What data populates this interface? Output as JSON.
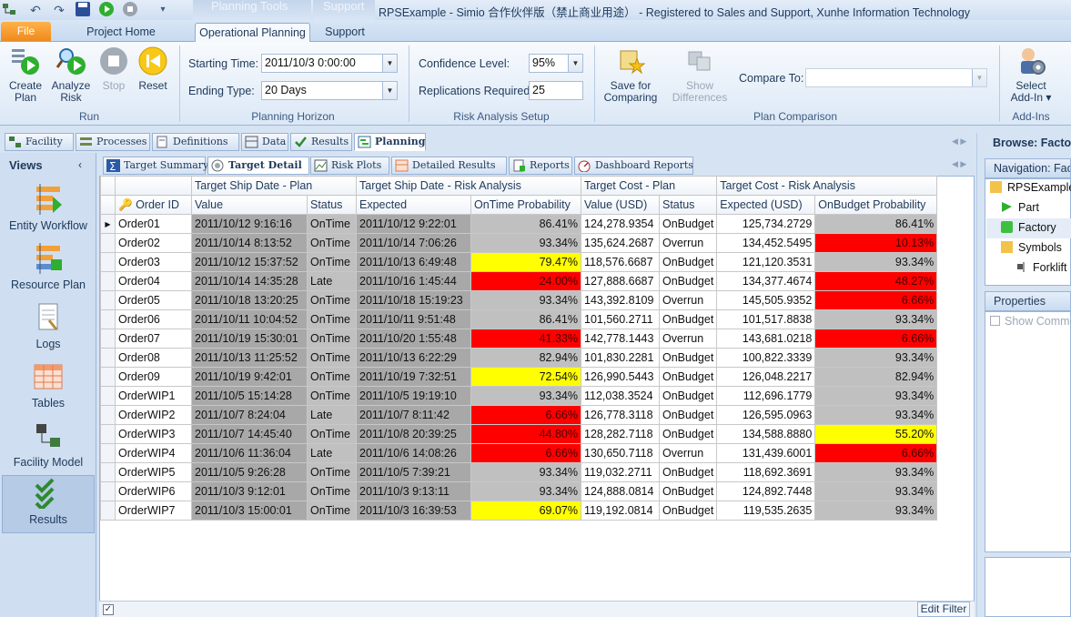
{
  "title_bar": {
    "text": "RPSExample - Simio 合作伙伴版（禁止商业用途） - Registered to Sales and Support, Xunhe Information Technology",
    "context_tabs": [
      "Planning Tools",
      "Support"
    ]
  },
  "ribbon_tabs": {
    "file": "File",
    "project_home": "Project Home",
    "operational_planning": "Operational Planning",
    "support": "Support"
  },
  "ribbon": {
    "run": {
      "label": "Run",
      "buttons": [
        "Create Plan",
        "Analyze Risk",
        "Stop",
        "Reset"
      ]
    },
    "planning_horizon": {
      "label": "Planning Horizon",
      "starting_time_label": "Starting Time:",
      "starting_time_value": "2011/10/3 0:00:00",
      "ending_type_label": "Ending Type:",
      "ending_type_value": "20 Days"
    },
    "risk_analysis_setup": {
      "label": "Risk Analysis Setup",
      "confidence_label": "Confidence Level:",
      "confidence_value": "95%",
      "replications_label": "Replications Required:",
      "replications_value": "25"
    },
    "plan_comparison": {
      "label": "Plan Comparison",
      "save_btn": "Save for Comparing",
      "show_diff_btn": "Show Differences",
      "compare_to_label": "Compare To:"
    },
    "add_ins": {
      "label": "Add-Ins",
      "select_btn": "Select Add-In"
    }
  },
  "doc_tabs": [
    "Facility",
    "Processes",
    "Definitions",
    "Data",
    "Results",
    "Planning"
  ],
  "views": {
    "title": "Views",
    "items": [
      "Entity Workflow",
      "Resource Plan",
      "Logs",
      "Tables",
      "Facility Model",
      "Results"
    ]
  },
  "inner_tabs": [
    "Target Summary",
    "Target Detail",
    "Risk Plots",
    "Detailed Results",
    "Reports",
    "Dashboard Reports"
  ],
  "grid": {
    "group_headers": [
      "Target Ship Date -  Plan",
      "Target Ship Date -  Risk  Analysis",
      "Target Cost -  Plan",
      "Target Cost -  Risk  Analysis"
    ],
    "columns": [
      "Order ID",
      "Value",
      "Status",
      "Expected",
      "OnTime Probability",
      "Value (USD)",
      "Status",
      "Expected (USD)",
      "OnBudget Probability"
    ],
    "rows": [
      [
        "Order01",
        "2011/10/12 9:16:16",
        "OnTime",
        "2011/10/12 9:22:01",
        "86.41%",
        "124,278.9354",
        "OnBudget",
        "125,734.2729",
        "86.41%"
      ],
      [
        "Order02",
        "2011/10/14 8:13:52",
        "OnTime",
        "2011/10/14 7:06:26",
        "93.34%",
        "135,624.2687",
        "Overrun",
        "134,452.5495",
        "10.13%"
      ],
      [
        "Order03",
        "2011/10/12 15:37:52",
        "OnTime",
        "2011/10/13 6:49:48",
        "79.47%",
        "118,576.6687",
        "OnBudget",
        "121,120.3531",
        "93.34%"
      ],
      [
        "Order04",
        "2011/10/14 14:35:28",
        "Late",
        "2011/10/16 1:45:44",
        "24.00%",
        "127,888.6687",
        "OnBudget",
        "134,377.4674",
        "48.27%"
      ],
      [
        "Order05",
        "2011/10/18 13:20:25",
        "OnTime",
        "2011/10/18 15:19:23",
        "93.34%",
        "143,392.8109",
        "Overrun",
        "145,505.9352",
        "6.66%"
      ],
      [
        "Order06",
        "2011/10/11 10:04:52",
        "OnTime",
        "2011/10/11 9:51:48",
        "86.41%",
        "101,560.2711",
        "OnBudget",
        "101,517.8838",
        "93.34%"
      ],
      [
        "Order07",
        "2011/10/19 15:30:01",
        "OnTime",
        "2011/10/20 1:55:48",
        "41.33%",
        "142,778.1443",
        "Overrun",
        "143,681.0218",
        "6.66%"
      ],
      [
        "Order08",
        "2011/10/13 11:25:52",
        "OnTime",
        "2011/10/13 6:22:29",
        "82.94%",
        "101,830.2281",
        "OnBudget",
        "100,822.3339",
        "93.34%"
      ],
      [
        "Order09",
        "2011/10/19 9:42:01",
        "OnTime",
        "2011/10/19 7:32:51",
        "72.54%",
        "126,990.5443",
        "OnBudget",
        "126,048.2217",
        "82.94%"
      ],
      [
        "OrderWIP1",
        "2011/10/5 15:14:28",
        "OnTime",
        "2011/10/5 19:19:10",
        "93.34%",
        "112,038.3524",
        "OnBudget",
        "112,696.1779",
        "93.34%"
      ],
      [
        "OrderWIP2",
        "2011/10/7 8:24:04",
        "Late",
        "2011/10/7 8:11:42",
        "6.66%",
        "126,778.3118",
        "OnBudget",
        "126,595.0963",
        "93.34%"
      ],
      [
        "OrderWIP3",
        "2011/10/7 14:45:40",
        "OnTime",
        "2011/10/8 20:39:25",
        "44.80%",
        "128,282.7118",
        "OnBudget",
        "134,588.8880",
        "55.20%"
      ],
      [
        "OrderWIP4",
        "2011/10/6 11:36:04",
        "Late",
        "2011/10/6 14:08:26",
        "6.66%",
        "130,650.7118",
        "Overrun",
        "131,439.6001",
        "6.66%"
      ],
      [
        "OrderWIP5",
        "2011/10/5 9:26:28",
        "OnTime",
        "2011/10/5 7:39:21",
        "93.34%",
        "119,032.2711",
        "OnBudget",
        "118,692.3691",
        "93.34%"
      ],
      [
        "OrderWIP6",
        "2011/10/3 9:12:01",
        "OnTime",
        "2011/10/3 9:13:11",
        "93.34%",
        "124,888.0814",
        "OnBudget",
        "124,892.7448",
        "93.34%"
      ],
      [
        "OrderWIP7",
        "2011/10/3 15:00:01",
        "OnTime",
        "2011/10/3 16:39:53",
        "69.07%",
        "119,192.0814",
        "OnBudget",
        "119,535.2635",
        "93.34%"
      ]
    ],
    "ontime_colors": [
      "gray",
      "gray",
      "yel",
      "red",
      "gray",
      "gray",
      "red",
      "gray",
      "yel",
      "gray",
      "red",
      "red",
      "red",
      "gray",
      "gray",
      "yel"
    ],
    "onbudget_colors": [
      "gray",
      "red",
      "gray",
      "red",
      "red",
      "gray",
      "red",
      "gray",
      "gray",
      "gray",
      "gray",
      "yel",
      "red",
      "gray",
      "gray",
      "gray"
    ],
    "edit_filter": "Edit Filter"
  },
  "right_panel": {
    "browse_title": "Browse: Facto",
    "navigation_title": "Navigation: Fact",
    "tree": [
      "RPSExample",
      "Part",
      "Factory",
      "Symbols",
      "Forklift"
    ],
    "properties_title": "Properties",
    "show_common": "Show Commo"
  },
  "colors": {
    "accent_orange": "#f08a1c",
    "ribbon_blue": "#d6e3f2",
    "highlight_red": "#ff0000",
    "highlight_yellow": "#ffff00"
  }
}
